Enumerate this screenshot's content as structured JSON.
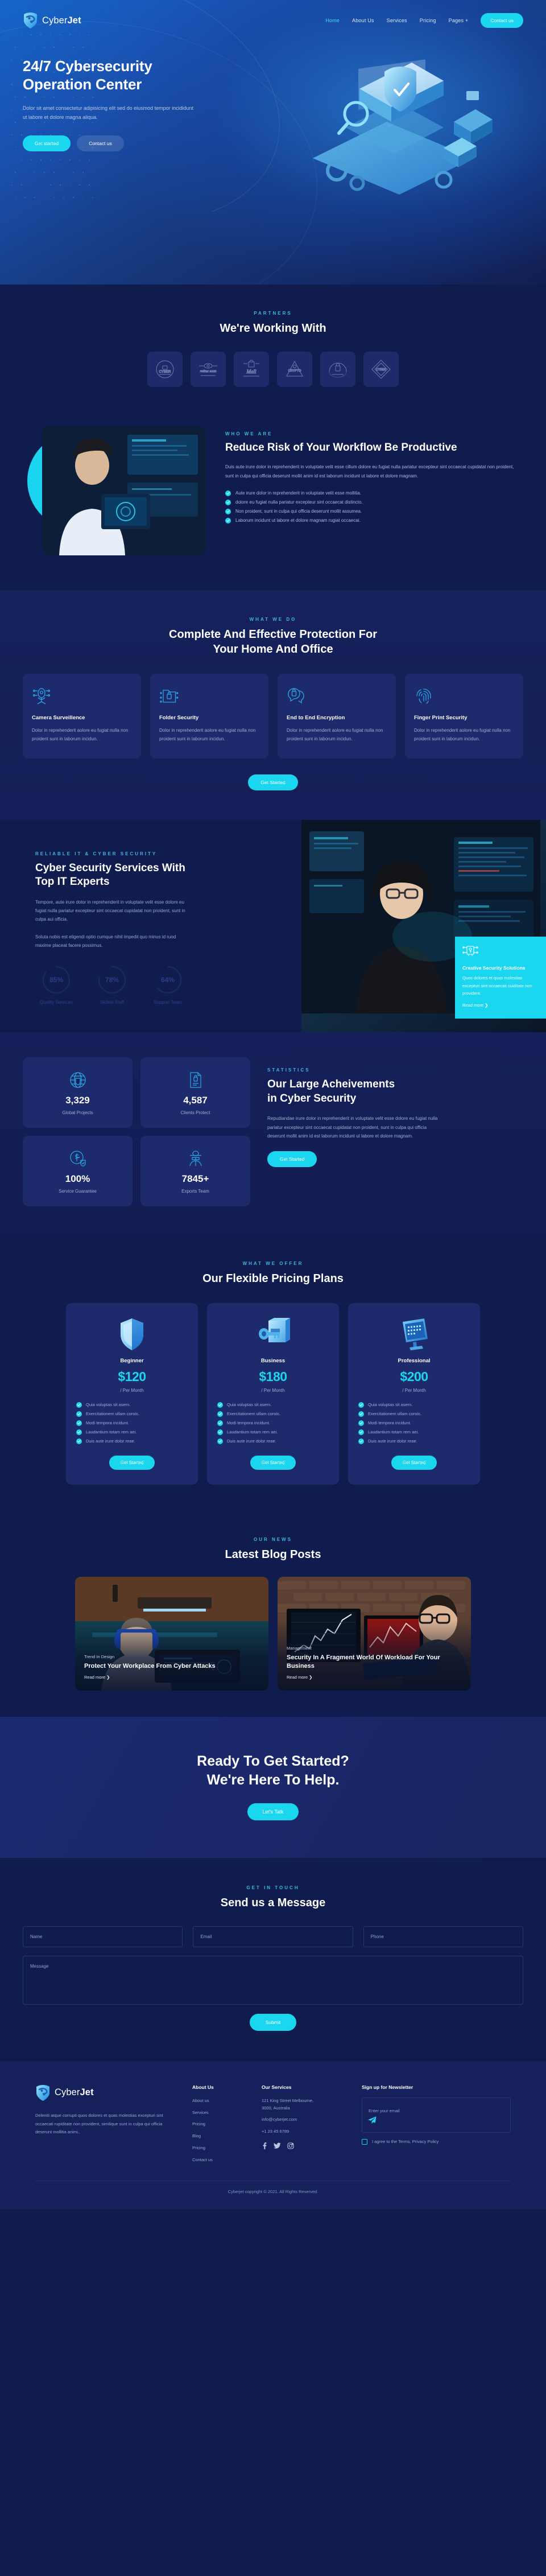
{
  "brand": {
    "name_light": "Cyber",
    "name_bold": "Jet",
    "logo_icon": "shield-network-logo"
  },
  "nav": {
    "links": [
      {
        "label": "Home",
        "active": true
      },
      {
        "label": "About Us",
        "active": false
      },
      {
        "label": "Services",
        "active": false
      },
      {
        "label": "Pricing",
        "active": false
      },
      {
        "label": "Pages +",
        "active": false
      }
    ],
    "cta_label": "Contact us"
  },
  "hero": {
    "title_line1": "24/7 Cybersecurity",
    "title_line2": "Operation Center",
    "subtitle": "Dolor sit amet consectetur adipisicing elit sed do eiusmod tempor incididunt ut labore et dolore magna aliqua.",
    "primary_label": "Get started",
    "secondary_label": "Contact us"
  },
  "partners": {
    "eyebrow": "PARTNERS",
    "title": "We're Working With",
    "logos": [
      {
        "name": "cyber-badge-logo",
        "text": "CYBER"
      },
      {
        "name": "retina-scan-logo",
        "text": "retina scan"
      },
      {
        "name": "mall-logo",
        "text": "Mall"
      },
      {
        "name": "crypto-logo",
        "text": "CRYPTO"
      },
      {
        "name": "lock-shield-logo",
        "text": ""
      },
      {
        "name": "cyber-diamond-logo",
        "text": "CYBER"
      }
    ]
  },
  "about": {
    "eyebrow": "WHO WE ARE",
    "title": "Reduce Risk of Your Workflow Be Productive",
    "body": "Duis aute irure dolor in reprehenderit in voluptate velit esse cillum dolore eu fugiat nulla pariatur excepteur sint occaecat cupidatat non proident, sunt in culpa qui officia deserunt mollit anim id est laborum incidunt ut labore et dolore magnam.",
    "checklist": [
      "Aute irure dolor in reprehenderit in voluptate velit esse mollitia.",
      "dolore eu fugiat nulla pariatur excepteur sint occaecat distincto.",
      "Non proident, sunt in culpa qui officia deserunt mollit assumea.",
      "Laborum incidunt ut labore et dolore magnam rugiat occaecai."
    ]
  },
  "services": {
    "eyebrow": "WHAT WE DO",
    "title_line1": "Complete And Effective Protection For",
    "title_line2": "Your Home And Office",
    "cards": [
      {
        "icon": "camera-surveillance-icon",
        "title": "Camera Surveillence",
        "text": "Dolor in reprehenderit aolore eu fugiat nulla non proident sunt in laborum incidun."
      },
      {
        "icon": "folder-lock-icon",
        "title": "Folder Security",
        "text": "Dolor in reprehenderit aolore eu fugiat nulla non proident sunt in laborum incidun."
      },
      {
        "icon": "end-to-end-encryption-icon",
        "title": "End to End Encryption",
        "text": "Dolor in reprehenderit aolore eu fugiat nulla non proident sunt in laborum incidun."
      },
      {
        "icon": "fingerprint-icon",
        "title": "Finger Print Security",
        "text": "Dolor in reprehenderit aolore eu fugiat nulla non proident sunt in laborum incidun."
      }
    ],
    "cta_label": "Get Started"
  },
  "reliable": {
    "eyebrow": "RELIABLE IT & CYBER SECURITY",
    "title": "Cyber Security Services With Top IT Experts",
    "para1": "Tempore, aute irure dolor in reprehenderit in voluptate velit esse dolore eu fugiat nulla pariatur excepteur sint occaecat cupidatat non proident, sunt in culpa aui officia.",
    "para2": "Soluta nobis est eligendi optio cumque nihil impedit quo minus id ruod maxime placeat facere possimus.",
    "skills": [
      {
        "value": "85%",
        "label": "Quality Services",
        "percent": 85
      },
      {
        "value": "78%",
        "label": "Skilled Staff",
        "percent": 78
      },
      {
        "value": "64%",
        "label": "Support Team",
        "percent": 64
      }
    ],
    "solutions": {
      "icon": "key-circuit-icon",
      "title": "Creative Security Solutions",
      "text": "Quos dolores et quas molestias excepturi sint occaecati cuiditate non provident.",
      "link_label": "Read more ❯"
    }
  },
  "statistics": {
    "eyebrow": "STATISTICS",
    "title_line1": "Our Large Acheivements",
    "title_line2": "in Cyber Security",
    "body": "Repudiandae irure dolor in reprehenderit in voluptate velit esse dolore eu fugiat nulla pariatur excepteur sint occaecat cupidatat non proident, sunt in culpa qui officia deserunt mollit anim id est laborum incidunt ut labore et dolore magnam.",
    "cta_label": "Get Started",
    "cards": [
      {
        "icon": "globe-shield-icon",
        "value": "3,329",
        "label": "Global Projects"
      },
      {
        "icon": "document-lock-icon",
        "value": "4,587",
        "label": "Clients Protect"
      },
      {
        "icon": "dollar-shield-icon",
        "value": "100%",
        "label": "Service Guarantee"
      },
      {
        "icon": "hacker-icon",
        "value": "7845+",
        "label": "Exports Team"
      }
    ]
  },
  "pricing": {
    "eyebrow": "WHAT WE OFFER",
    "title": "Our Flexible Pricing Plans",
    "features": [
      "Quia voluptas sit asern.",
      "Exercitationem ullam corois.",
      "Modi tempora incidunt.",
      "Laudantium totam rem aei.",
      "Duis aute irure dolor reae."
    ],
    "plans": [
      {
        "art": "shield-3d-art",
        "tier": "Beginner",
        "amount": "$120",
        "period": "/ Per Month",
        "cta_label": "Get Started"
      },
      {
        "art": "key-folder-3d-art",
        "tier": "Business",
        "amount": "$180",
        "period": "/ Per Month",
        "cta_label": "Get Started"
      },
      {
        "art": "monitor-password-3d-art",
        "tier": "Professional",
        "amount": "$200",
        "period": "/ Per Month",
        "cta_label": "Get Started"
      }
    ]
  },
  "blog": {
    "eyebrow": "OUR NEWS",
    "title": "Latest Blog Posts",
    "posts": [
      {
        "category": "Trend In Design",
        "title": "Protect Your Workplace From Cyber Attacks",
        "link_label": "Read more ❯"
      },
      {
        "category": "Management",
        "title": "Security In A Fragment World Of Workload For Your Business",
        "link_label": "Read more ❯"
      }
    ]
  },
  "cta": {
    "title_line1": "Ready To Get Started?",
    "title_line2": "We're Here To Help.",
    "button_label": "Let's Talk"
  },
  "contact": {
    "eyebrow": "GET IN TOUCH",
    "title": "Send us a Message",
    "name_placeholder": "Name",
    "email_placeholder": "Email",
    "phone_placeholder": "Phone",
    "message_placeholder": "Message",
    "submit_label": "Submit"
  },
  "footer": {
    "description": "Deleniti atque corrupti quos dolores et quas molestias excepturi sint occaecati rupiditate non provident, similique sunt in culpa qui officia deserunt mollitia animi..",
    "about": {
      "heading": "About Us",
      "links": [
        "About us",
        "Services",
        "Pricing",
        "Blog",
        "Pricing",
        "Contact us"
      ]
    },
    "services": {
      "heading": "Our Services",
      "address_line1": "121 King Street Melbourne,",
      "address_line2": "3000, Australia",
      "email": "info@cyberjet.com",
      "phone": "+1 23 45 6789",
      "socials": [
        "facebook-icon",
        "twitter-icon",
        "instagram-icon"
      ]
    },
    "newsletter": {
      "heading": "Sign up for Newsletter",
      "placeholder": "Enter your email",
      "send_icon": "send-plane-icon",
      "agree_label": "I agree to the Terms, Privacy Policy"
    },
    "copyright": "Cyberjet copyright © 2021. All Rights Reserved."
  },
  "colors": {
    "accent": "#1ad6ef",
    "deep_navy": "#111c4e",
    "card_navy": "#1d2a6b",
    "eyebrow": "#3ab9dd"
  }
}
